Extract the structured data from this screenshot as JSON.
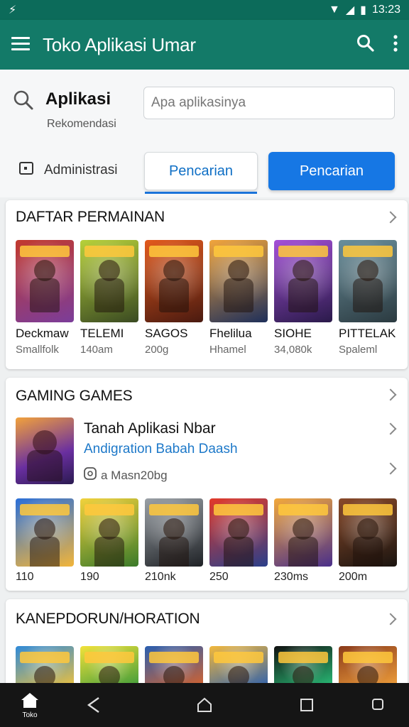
{
  "status": {
    "time": "13:23"
  },
  "appbar": {
    "title": "Toko Aplikasi Umar"
  },
  "search": {
    "label": "Aplikasi",
    "sublabel": "Rekomendasi",
    "placeholder": "Apa aplikasinya"
  },
  "filter": {
    "label": "Administrasi"
  },
  "buttons": {
    "outline_label": "Pencarian",
    "fill_label": "Pencarian"
  },
  "sections": [
    {
      "title": "DAFTAR PERMAINAN",
      "tiles": [
        {
          "name": "Deckmaw",
          "meta": "Smallfolk",
          "colors": [
            "#c23a2e",
            "#7b3d9a"
          ]
        },
        {
          "name": "TELEMI",
          "meta": "140am",
          "colors": [
            "#b7d13a",
            "#3a4a22"
          ]
        },
        {
          "name": "SAGOS",
          "meta": "200g",
          "colors": [
            "#e35a1d",
            "#4a1a10"
          ]
        },
        {
          "name": "Fhelilua",
          "meta": "Hhamel",
          "colors": [
            "#f2a53c",
            "#1e2f5a"
          ]
        },
        {
          "name": "SIOHE",
          "meta": "34,080k",
          "colors": [
            "#a450d8",
            "#2a1a4a"
          ]
        },
        {
          "name": "PITTELAK",
          "meta": "Spaleml",
          "colors": [
            "#6a8f9c",
            "#2b3a40"
          ]
        }
      ]
    },
    {
      "title": "GAMING GAMES",
      "featured": {
        "title": "Tanah Aplikasi Nbar",
        "subtitle": "Andigration Babah Daash",
        "meta": "a Masn20bg"
      },
      "tiles": [
        {
          "rating": "110",
          "colors": [
            "#2a6fd9",
            "#f2b53a"
          ]
        },
        {
          "rating": "190",
          "colors": [
            "#f2d23c",
            "#3a7a2a"
          ]
        },
        {
          "rating": "210nk",
          "colors": [
            "#9aa0a6",
            "#1f2226"
          ]
        },
        {
          "rating": "250",
          "colors": [
            "#e33a2a",
            "#2a3f8a"
          ]
        },
        {
          "rating": "230ms",
          "colors": [
            "#f2a83c",
            "#4a2f8a"
          ]
        },
        {
          "rating": "200m",
          "colors": [
            "#8a4a2a",
            "#1a1410"
          ]
        }
      ]
    },
    {
      "title": "KANEPDORUN/HORATION",
      "tiles": [
        {
          "colors": [
            "#2f8ad9",
            "#f2c23a"
          ]
        },
        {
          "colors": [
            "#f2e23a",
            "#3a9a3a"
          ]
        },
        {
          "colors": [
            "#2a5fb0",
            "#d9632a"
          ]
        },
        {
          "colors": [
            "#f2b83c",
            "#2a5fb0"
          ]
        },
        {
          "colors": [
            "#111111",
            "#2ac27a"
          ]
        },
        {
          "colors": [
            "#8a3a1a",
            "#f2a23c"
          ]
        }
      ]
    }
  ],
  "navbar": {
    "home_label": "Toko"
  }
}
